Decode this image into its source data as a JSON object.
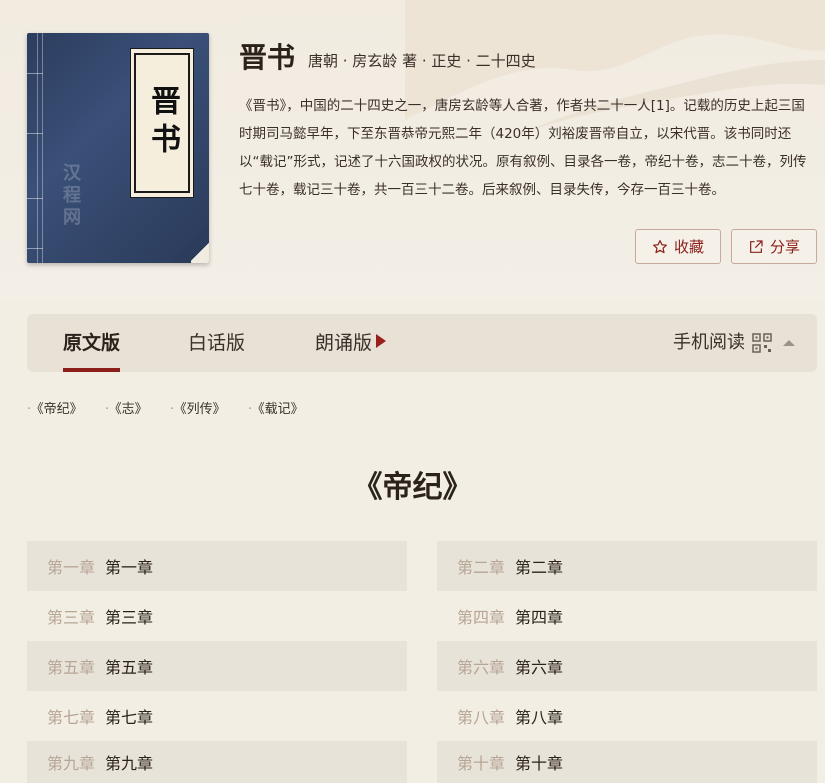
{
  "book": {
    "title": "晋书",
    "meta": "唐朝 · 房玄龄 著 · 正史 · 二十四史",
    "cover_title": "晋书",
    "watermark": "汉程网",
    "description": "《晋书》，中国的二十四史之一，唐房玄龄等人合著，作者共二十一人[1]。记载的历史上起三国时期司马懿早年，下至东晋恭帝元熙二年（420年）刘裕废晋帝自立，以宋代晋。该书同时还以“载记”形式，记述了十六国政权的状况。原有叙例、目录各一卷，帝纪十卷，志二十卷，列传七十卷，载记三十卷，共一百三十二卷。后来叙例、目录失传，今存一百三十卷。"
  },
  "actions": {
    "favorite_label": "收藏",
    "share_label": "分享"
  },
  "tabs": {
    "original": "原文版",
    "vernacular": "白话版",
    "recital": "朗诵版",
    "mobile_read": "手机阅读"
  },
  "sections": [
    "《帝纪》",
    "《志》",
    "《列传》",
    "《载记》"
  ],
  "current_section": "《帝纪》",
  "chapters": [
    {
      "num": "第一章",
      "name": "第一章"
    },
    {
      "num": "第二章",
      "name": "第二章"
    },
    {
      "num": "第三章",
      "name": "第三章"
    },
    {
      "num": "第四章",
      "name": "第四章"
    },
    {
      "num": "第五章",
      "name": "第五章"
    },
    {
      "num": "第六章",
      "name": "第六章"
    },
    {
      "num": "第七章",
      "name": "第七章"
    },
    {
      "num": "第八章",
      "name": "第八章"
    },
    {
      "num": "第九章",
      "name": "第九章"
    },
    {
      "num": "第十章",
      "name": "第十章"
    }
  ],
  "colors": {
    "accent": "#8b1d1a",
    "background": "#f2eee4",
    "row_shade": "#e8e3d9",
    "chapter_num": "#b7a596"
  }
}
